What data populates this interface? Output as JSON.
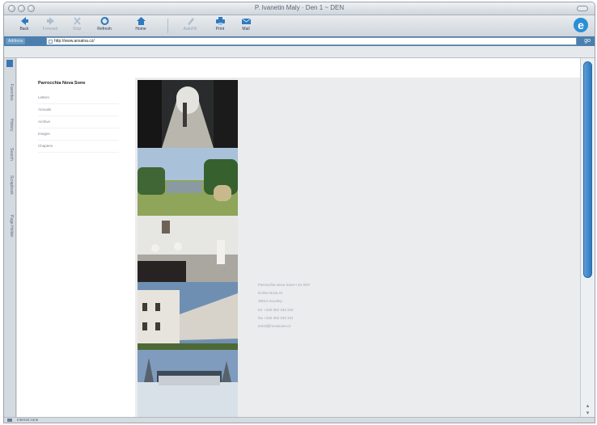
{
  "window": {
    "title": "P. Ivanetin Maly · Den 1 ~ DEN"
  },
  "toolbar": {
    "buttons": [
      {
        "label": "Back",
        "icon": "back-arrow-icon",
        "enabled": true
      },
      {
        "label": "Forward",
        "icon": "forward-arrow-icon",
        "enabled": false
      },
      {
        "label": "Stop",
        "icon": "stop-icon",
        "enabled": false
      },
      {
        "label": "Refresh",
        "icon": "refresh-icon",
        "enabled": true
      },
      {
        "label": "Home",
        "icon": "home-icon",
        "enabled": true
      },
      {
        "label": "AutoFill",
        "icon": "autofill-icon",
        "enabled": false
      },
      {
        "label": "Print",
        "icon": "print-icon",
        "enabled": true
      },
      {
        "label": "Mail",
        "icon": "mail-icon",
        "enabled": true
      }
    ]
  },
  "addressbar": {
    "label": "Address",
    "url": "http://www.ansalna.cz/",
    "go_label": "go"
  },
  "explorer_bar": {
    "tabs": [
      "Favorites",
      "History",
      "Search",
      "Scrapbook",
      "Page Holder"
    ]
  },
  "site": {
    "title": "Parrocchia Nova Sone",
    "nav": [
      "Letters",
      "Annuals",
      "Archive",
      "Images",
      "Chapters"
    ],
    "address_lines": [
      "Parrocchia Nova Sone • Z1 0/07",
      "Dolina Nova 21",
      "39013 Scuoley",
      "tel. +420 352 333 222",
      "fax +420 352 333 321",
      "email@novasone.cz"
    ]
  },
  "status": {
    "text": "Internet zone"
  },
  "colors": {
    "accent": "#2f79bf",
    "address_bar": "#4a7fae",
    "content_background": "#ebecee"
  }
}
